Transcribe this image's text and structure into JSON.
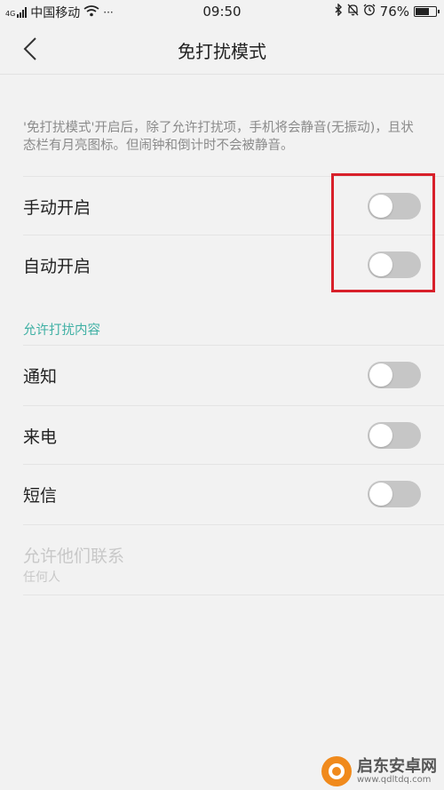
{
  "status_bar": {
    "carrier": "中国移动",
    "signal_badge": "4G",
    "more": "···",
    "time": "09:50",
    "battery_percent": "76%",
    "battery_level": 0.76
  },
  "header": {
    "title": "免打扰模式"
  },
  "description": "'免打扰模式'开启后，除了允许打扰项，手机将会静音(无振动)，且状态栏有月亮图标。但闹钟和倒计时不会被静音。",
  "toggles": [
    {
      "label": "手动开启",
      "on": false
    },
    {
      "label": "自动开启",
      "on": false
    }
  ],
  "allow_section": {
    "header": "允许打扰内容",
    "items": [
      {
        "label": "通知",
        "on": false
      },
      {
        "label": "来电",
        "on": false
      },
      {
        "label": "短信",
        "on": false
      }
    ]
  },
  "allow_contacts": {
    "title": "允许他们联系",
    "value": "任何人"
  },
  "colors": {
    "accent": "#3fb0a4",
    "highlight": "#d8202a",
    "toggle_off": "#c6c6c6"
  },
  "watermark": {
    "name": "启东安卓网",
    "url": "www.qdltdq.com"
  }
}
